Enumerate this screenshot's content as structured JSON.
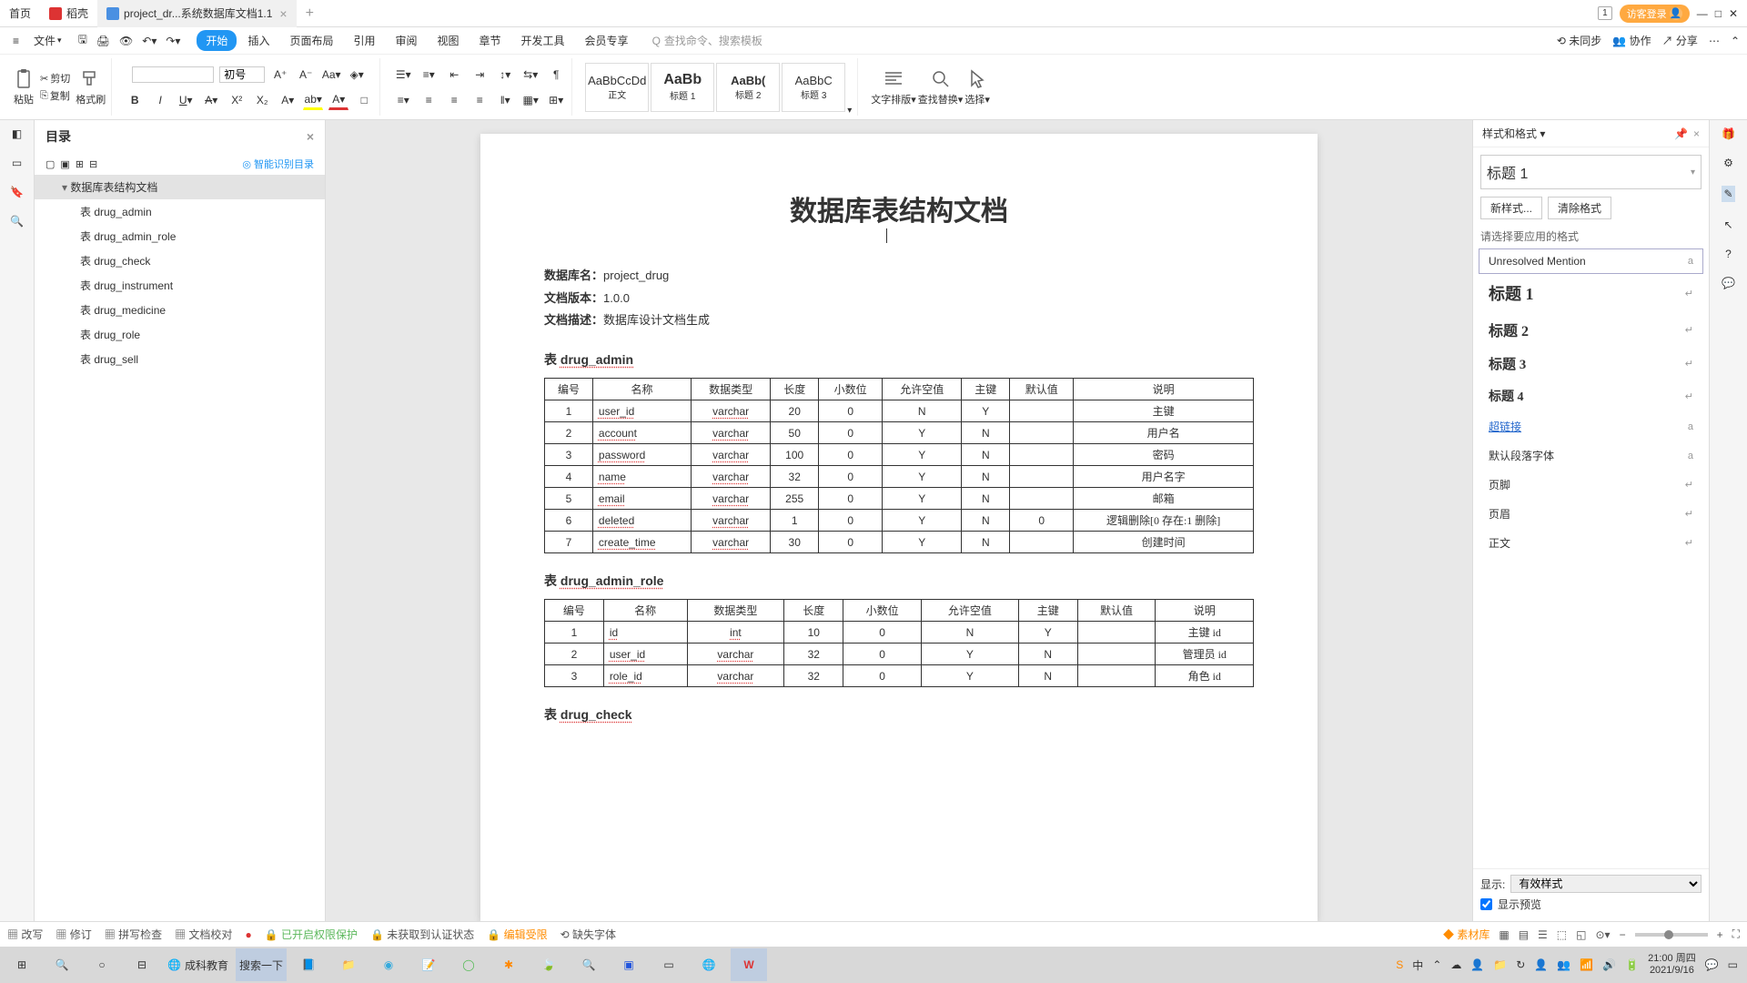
{
  "tabs": {
    "home": "首页",
    "docker": "稻壳",
    "doc": "project_dr...系统数据库文档1.1"
  },
  "login": "访客登录",
  "file_menu": "文件",
  "ribbon_tabs": [
    "开始",
    "插入",
    "页面布局",
    "引用",
    "审阅",
    "视图",
    "章节",
    "开发工具",
    "会员专享"
  ],
  "search_ph": "查找命令、搜索模板",
  "right_menu": {
    "sync": "未同步",
    "collab": "协作",
    "share": "分享"
  },
  "clip": {
    "paste": "粘贴",
    "cut": "剪切",
    "copy": "复制",
    "brush": "格式刷"
  },
  "font": {
    "name": "",
    "size": "初号"
  },
  "styles": {
    "p1": "AaBbCcDd",
    "p1l": "正文",
    "p2": "AaBb",
    "p2l": "标题 1",
    "p3": "AaBb(",
    "p3l": "标题 2",
    "p4": "AaBbC",
    "p4l": "标题 3"
  },
  "ribbon_right": {
    "type": "文字排版",
    "find": "查找替换",
    "sel": "选择"
  },
  "outline": {
    "title": "目录",
    "smart": "智能识别目录",
    "root": "数据库表结构文档",
    "items": [
      "表 drug_admin",
      "表 drug_admin_role",
      "表 drug_check",
      "表 drug_instrument",
      "表 drug_medicine",
      "表 drug_role",
      "表 drug_sell"
    ]
  },
  "doc": {
    "h1": "数据库表结构文档",
    "k1": "数据库名：",
    "v1": "project_drug",
    "k2": "文档版本：",
    "v2": "1.0.0",
    "k3": "文档描述：",
    "v3": "数据库设计文档生成",
    "t1": "表 drug_admin",
    "hdr": [
      "编号",
      "名称",
      "数据类型",
      "长度",
      "小数位",
      "允许空值",
      "主键",
      "默认值",
      "说明"
    ],
    "rows1": [
      [
        "1",
        "user_id",
        "varchar",
        "20",
        "0",
        "N",
        "Y",
        "",
        "主键"
      ],
      [
        "2",
        "account",
        "varchar",
        "50",
        "0",
        "Y",
        "N",
        "",
        "用户名"
      ],
      [
        "3",
        "password",
        "varchar",
        "100",
        "0",
        "Y",
        "N",
        "",
        "密码"
      ],
      [
        "4",
        "name",
        "varchar",
        "32",
        "0",
        "Y",
        "N",
        "",
        "用户名字"
      ],
      [
        "5",
        "email",
        "varchar",
        "255",
        "0",
        "Y",
        "N",
        "",
        "邮箱"
      ],
      [
        "6",
        "deleted",
        "varchar",
        "1",
        "0",
        "Y",
        "N",
        "0",
        "逻辑删除[0 存在:1 删除]"
      ],
      [
        "7",
        "create_time",
        "varchar",
        "30",
        "0",
        "Y",
        "N",
        "",
        "创建时间"
      ]
    ],
    "t2": "表 drug_admin_role",
    "rows2": [
      [
        "1",
        "id",
        "int",
        "10",
        "0",
        "N",
        "Y",
        "",
        "主键 id"
      ],
      [
        "2",
        "user_id",
        "varchar",
        "32",
        "0",
        "Y",
        "N",
        "",
        "管理员 id"
      ],
      [
        "3",
        "role_id",
        "varchar",
        "32",
        "0",
        "Y",
        "N",
        "",
        "角色 id"
      ]
    ],
    "t3": "表 drug_check"
  },
  "rp": {
    "title": "样式和格式",
    "current": "标题 1",
    "new": "新样式...",
    "clear": "清除格式",
    "hint": "请选择要应用的格式",
    "list": [
      "Unresolved Mention",
      "标题 1",
      "标题 2",
      "标题 3",
      "标题 4",
      "超链接",
      "默认段落字体",
      "页脚",
      "页眉",
      "正文"
    ],
    "show": "显示:",
    "showv": "有效样式",
    "preview": "显示预览"
  },
  "status": {
    "gz": "改写",
    "xd": "修订",
    "py": "拼写检查",
    "jd": "文档校对",
    "qx": "已开启权限保护",
    "rz": "未获取到认证状态",
    "bj": "编辑受限",
    "qz": "缺失字体",
    "sc": "素材库"
  },
  "tb": {
    "search": "搜索一下",
    "edu": "成科教育",
    "time": "21:00",
    "day": "周四",
    "date": "2021/9/16"
  }
}
